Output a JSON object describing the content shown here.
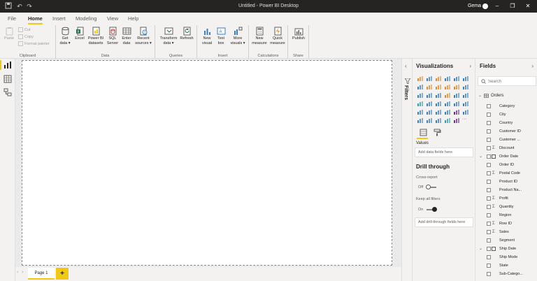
{
  "window": {
    "title": "Untitled - Power BI Desktop",
    "user": "Gema",
    "controls": {
      "minimize": "–",
      "restore": "❐",
      "close": "✕"
    }
  },
  "menu": {
    "tabs": [
      "File",
      "Home",
      "Insert",
      "Modeling",
      "View",
      "Help"
    ],
    "active": "Home"
  },
  "ribbon": {
    "clipboard": {
      "label": "Clipboard",
      "paste": "Paste",
      "cut": "Cut",
      "copy": "Copy",
      "format_painter": "Format painter"
    },
    "data": {
      "label": "Data",
      "get_data": [
        "Get",
        "data ▾"
      ],
      "excel": [
        "Excel"
      ],
      "datasets": [
        "Power BI",
        "datasets"
      ],
      "sql": [
        "SQL",
        "Server"
      ],
      "enter": [
        "Enter",
        "data"
      ],
      "recent": [
        "Recent",
        "sources ▾"
      ]
    },
    "queries": {
      "label": "Queries",
      "transform": [
        "Transform",
        "data ▾"
      ],
      "refresh": [
        "Refresh"
      ]
    },
    "insert": {
      "label": "Insert",
      "new_visual": [
        "New",
        "visual"
      ],
      "text_box": [
        "Text",
        "box"
      ],
      "more_visuals": [
        "More",
        "visuals ▾"
      ]
    },
    "calculations": {
      "label": "Calculations",
      "new_measure": [
        "New",
        "measure"
      ],
      "quick_measure": [
        "Quick",
        "measure"
      ]
    },
    "share": {
      "label": "Share",
      "publish": [
        "Publish"
      ]
    }
  },
  "pages": {
    "tabs": [
      "Page 1"
    ],
    "add": "+",
    "prev": "‹",
    "next": "›"
  },
  "filters": {
    "label": "Filters",
    "collapse": "‹"
  },
  "visualizations": {
    "title": "Visualizations",
    "chevron": "›",
    "values_label": "Values",
    "values_placeholder": "Add data fields here",
    "drill_title": "Drill through",
    "cross_report": "Cross-report",
    "cross_report_state": "Off",
    "keep_filters": "Keep all filters",
    "keep_filters_state": "On",
    "drill_placeholder": "Add drill-through fields here",
    "more": "···"
  },
  "fields": {
    "title": "Fields",
    "chevron": "›",
    "search_placeholder": "Search",
    "table": "Orders",
    "items": [
      {
        "name": "Category",
        "kind": "text"
      },
      {
        "name": "City",
        "kind": "text"
      },
      {
        "name": "Country",
        "kind": "text"
      },
      {
        "name": "Customer ID",
        "kind": "text"
      },
      {
        "name": "Customer ...",
        "kind": "text"
      },
      {
        "name": "Discount",
        "kind": "sum"
      },
      {
        "name": "Order Date",
        "kind": "date"
      },
      {
        "name": "Order ID",
        "kind": "text"
      },
      {
        "name": "Postal Code",
        "kind": "sum"
      },
      {
        "name": "Product ID",
        "kind": "text"
      },
      {
        "name": "Product Na...",
        "kind": "text"
      },
      {
        "name": "Profit",
        "kind": "sum"
      },
      {
        "name": "Quantity",
        "kind": "sum"
      },
      {
        "name": "Region",
        "kind": "text"
      },
      {
        "name": "Row ID",
        "kind": "sum"
      },
      {
        "name": "Sales",
        "kind": "sum"
      },
      {
        "name": "Segment",
        "kind": "text"
      },
      {
        "name": "Ship Date",
        "kind": "date"
      },
      {
        "name": "Ship Mode",
        "kind": "text"
      },
      {
        "name": "State",
        "kind": "text"
      },
      {
        "name": "Sub-Catego...",
        "kind": "text"
      }
    ]
  },
  "colors": {
    "accent": "#f2c811",
    "titlebar": "#252423",
    "viz_blue": "#3a7ec0",
    "viz_orange": "#e08a2c",
    "viz_purple": "#6b2f8a",
    "viz_teal": "#2a9fa8"
  }
}
